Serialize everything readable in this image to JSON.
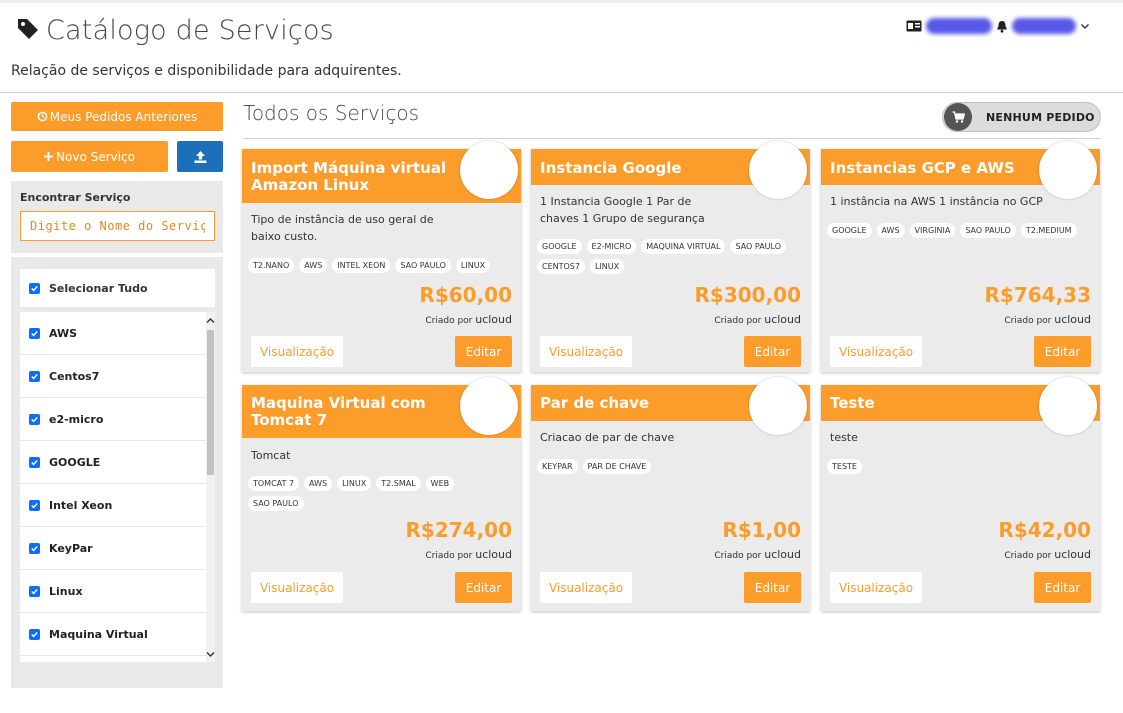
{
  "header": {
    "title": "Catálogo de Serviços",
    "subtitle": "Relação de serviços e disponibilidade para adquirentes.",
    "title_icon": "tag-icon",
    "user_icons": [
      "id-card-icon",
      "bell-icon",
      "chevron-down-icon"
    ]
  },
  "sidebar": {
    "prev_orders_label": "Meus Pedidos Anteriores",
    "new_service_label": "Novo Serviço",
    "upload_icon": "upload-icon",
    "search": {
      "label": "Encontrar Serviço",
      "placeholder": "Digite o Nome do Serviço"
    },
    "select_all_label": "Selecionar Tudo",
    "filters": [
      {
        "label": "AWS",
        "checked": true
      },
      {
        "label": "Centos7",
        "checked": true
      },
      {
        "label": "e2-micro",
        "checked": true
      },
      {
        "label": "GOOGLE",
        "checked": true
      },
      {
        "label": "Intel Xeon",
        "checked": true
      },
      {
        "label": "KeyPar",
        "checked": true
      },
      {
        "label": "Linux",
        "checked": true
      },
      {
        "label": "Maquina Virtual",
        "checked": true
      }
    ]
  },
  "main": {
    "section_title": "Todos os Serviços",
    "order_status": "NENHUM PEDIDO",
    "view_label": "Visualização",
    "edit_label": "Editar",
    "created_by_label": "Criado por",
    "cards": [
      {
        "title": "Import Máquina virtual Amazon Linux",
        "desc": "Tipo de instância de uso geral de baixo custo.",
        "tags": [
          "T2.NANO",
          "AWS",
          "INTEL XEON",
          "SAO PAULO",
          "LINUX"
        ],
        "price": "R$60,00",
        "creator": "ucloud"
      },
      {
        "title": "Instancia Google",
        "desc": "1 Instancia Google 1 Par de chaves 1 Grupo de segurança",
        "tags": [
          "GOOGLE",
          "E2-MICRO",
          "MAQUINA VIRTUAL",
          "SAO PAULO",
          "CENTOS7",
          "LINUX"
        ],
        "price": "R$300,00",
        "creator": "ucloud"
      },
      {
        "title": "Instancias GCP e AWS",
        "desc": "1 instância na AWS 1 instância no GCP",
        "tags": [
          "GOOGLE",
          "AWS",
          "VIRGINIA",
          "SAO PAULO",
          "T2.MEDIUM"
        ],
        "price": "R$764,33",
        "creator": "ucloud"
      },
      {
        "title": "Maquina Virtual com Tomcat 7",
        "desc": "Tomcat",
        "tags": [
          "TOMCAT 7",
          "AWS",
          "LINUX",
          "T2.SMAL",
          "WEB",
          "SAO PAULO"
        ],
        "price": "R$274,00",
        "creator": "ucloud"
      },
      {
        "title": "Par de chave",
        "desc": "Criacao de par de chave",
        "tags": [
          "KEYPAR",
          "PAR DE CHAVE"
        ],
        "price": "R$1,00",
        "creator": "ucloud"
      },
      {
        "title": "Teste",
        "desc": "teste",
        "tags": [
          "TESTE"
        ],
        "price": "R$42,00",
        "creator": "ucloud"
      }
    ]
  }
}
